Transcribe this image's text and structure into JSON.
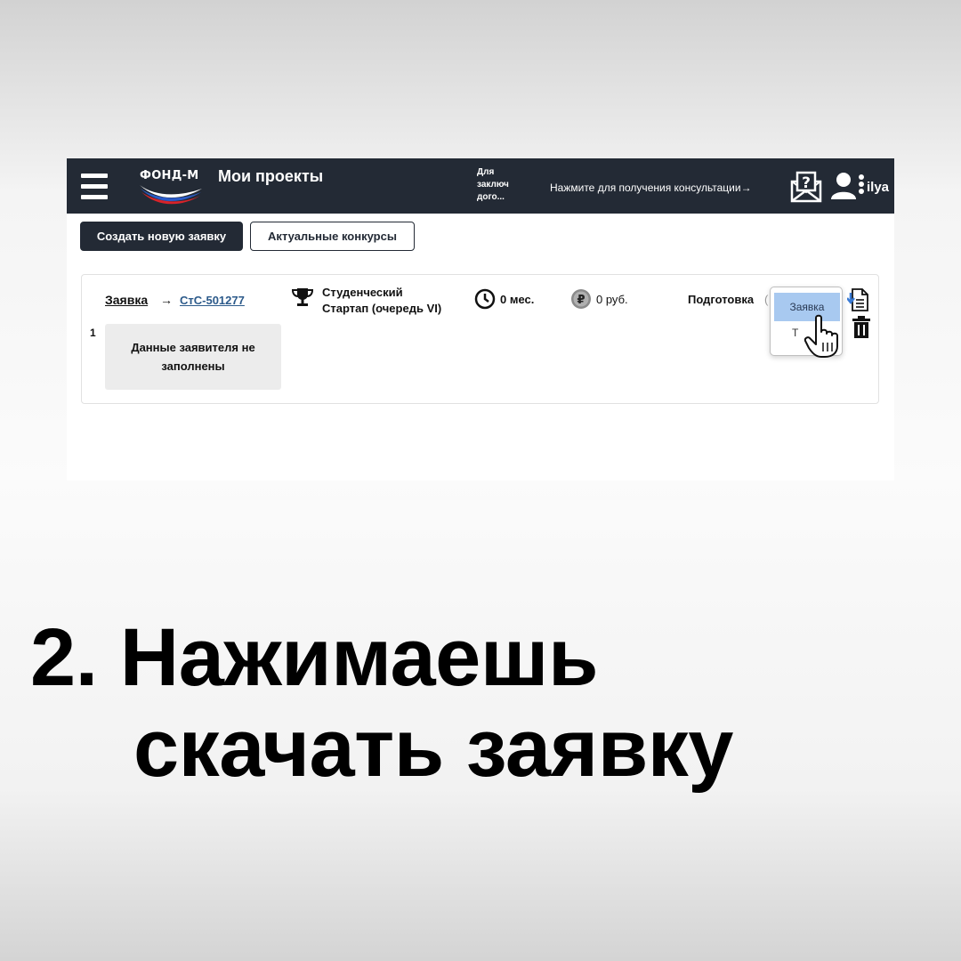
{
  "header": {
    "logo_text": "ФОНД-М",
    "app_title": "Мои проекты",
    "contract_note": "Для\nзаключ\nдого...",
    "consult_text": "Нажмите для получения консультации→",
    "username": "ilya",
    "colors": {
      "bar": "#232a35",
      "text": "#ffffff"
    }
  },
  "toolbar": {
    "create_label": "Создать новую заявку",
    "contests_label": "Актуальные конкурсы"
  },
  "application": {
    "row_number": "1",
    "type_label": "Заявка",
    "arrow": "→",
    "code": "СтС-501277",
    "applicant_status": "Данные заявителя не заполнены",
    "contest": "Студенческий\nСтартап (очередь VI)",
    "duration": "0 мес.",
    "amount": "0 руб.",
    "status": "Подготовка",
    "status_suffix": "(",
    "icons": [
      "trophy-icon",
      "clock-icon",
      "ruble-icon",
      "download-icon",
      "trash-icon"
    ]
  },
  "download_menu": {
    "option_label": "Заявка",
    "option2_label": "Т",
    "highlight_color": "#a8c9f0"
  },
  "caption": {
    "line1": "2. Нажимаешь",
    "line2": "скачать заявку"
  }
}
